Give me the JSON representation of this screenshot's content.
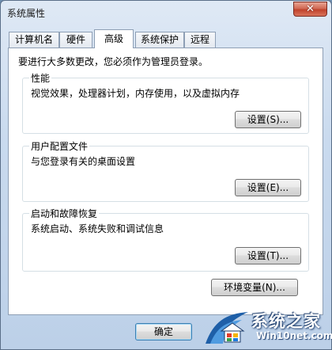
{
  "window": {
    "title": "系统属性"
  },
  "tabs": [
    {
      "label": "计算机名",
      "active": false
    },
    {
      "label": "硬件",
      "active": false
    },
    {
      "label": "高级",
      "active": true
    },
    {
      "label": "系统保护",
      "active": false
    },
    {
      "label": "远程",
      "active": false
    }
  ],
  "advanced": {
    "admin_note": "要进行大多数更改，您必须作为管理员登录。",
    "performance": {
      "title": "性能",
      "description": "视觉效果，处理器计划，内存使用，以及虚拟内存",
      "button": "设置(S)..."
    },
    "user_profiles": {
      "title": "用户配置文件",
      "description": "与您登录有关的桌面设置",
      "button": "设置(E)..."
    },
    "startup_recovery": {
      "title": "启动和故障恢复",
      "description": "系统启动、系统失败和调试信息",
      "button": "设置(T)..."
    },
    "env_button": "环境变量(N)..."
  },
  "footer": {
    "ok_button": "确定"
  },
  "watermark": {
    "site_name": "系统之家",
    "url": "Win10net.com"
  },
  "colors": {
    "accent": "#3c7fb1",
    "close": "#c0432c",
    "window_frame": "#bcd0e8"
  }
}
